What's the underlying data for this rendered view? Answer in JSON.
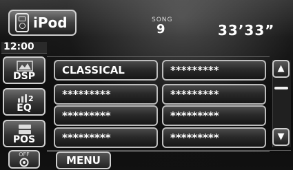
{
  "header": {
    "source_label": "iPod",
    "song_caption": "SONG",
    "song_number": "9",
    "elapsed_time": "33’33”"
  },
  "sidebar": {
    "clock": "12:00",
    "dsp_label": "DSP",
    "eq_label": "EQ",
    "eq_badge": "2",
    "pos_label": "POS",
    "off_label": "OFF"
  },
  "list": {
    "rows": [
      [
        "CLASSICAL",
        "*********"
      ],
      [
        "*********",
        "*********"
      ],
      [
        "*********",
        "*********"
      ],
      [
        "*********",
        "*********"
      ]
    ]
  },
  "scroll": {
    "up_icon": "triangle-up-icon",
    "down_icon": "triangle-down-icon"
  },
  "footer": {
    "menu_label": "MENU"
  }
}
